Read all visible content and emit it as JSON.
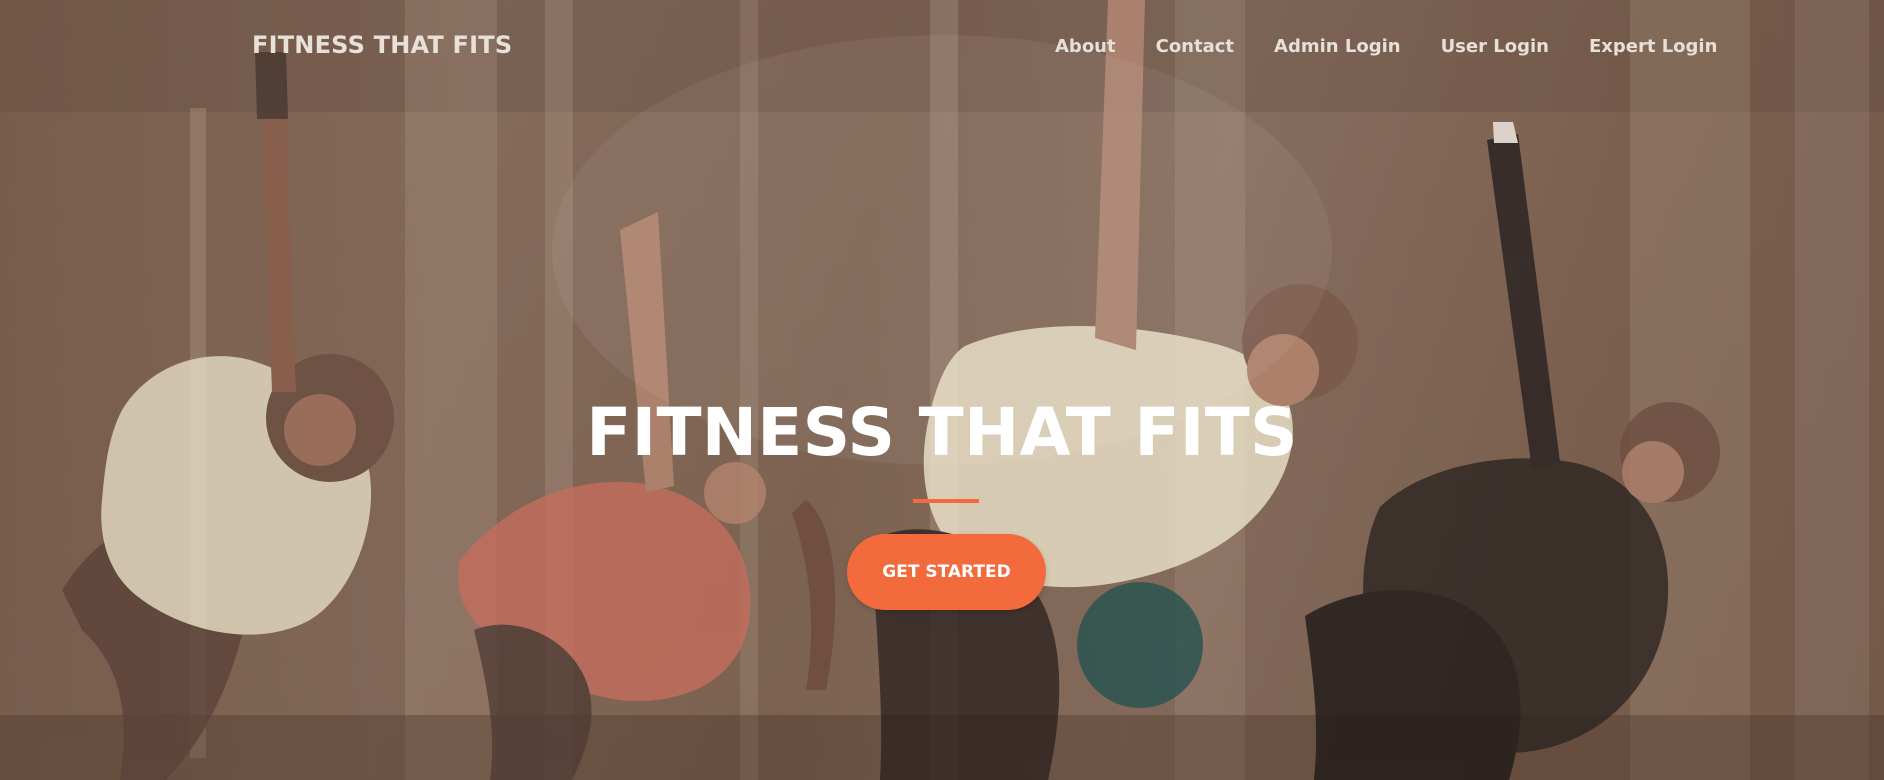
{
  "navbar": {
    "brand": "FITNESS THAT FITS",
    "links": [
      {
        "label": "About"
      },
      {
        "label": "Contact"
      },
      {
        "label": "Admin Login"
      },
      {
        "label": "User Login"
      },
      {
        "label": "Expert Login"
      }
    ]
  },
  "hero": {
    "title": "FITNESS THAT FITS",
    "cta_label": "GET STARTED",
    "background_image": "group-fitness-class-side-plank-stretch"
  },
  "colors": {
    "accent": "#f36b3d",
    "overlay": "#5c4033",
    "text": "#ffffff"
  }
}
